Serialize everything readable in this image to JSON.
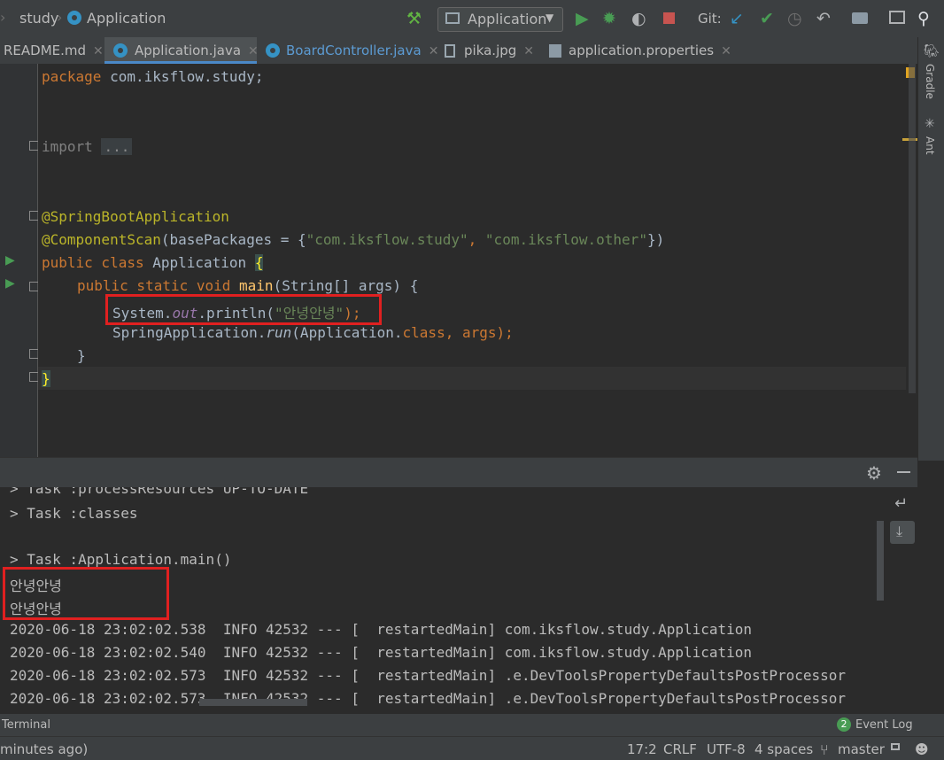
{
  "nav": {
    "breadcrumb_study": "study",
    "breadcrumb_file": "Application",
    "run_config": "Application",
    "git_label": "Git:"
  },
  "tabs": [
    {
      "label": "README.md"
    },
    {
      "label": "Application.java"
    },
    {
      "label": "BoardController.java"
    },
    {
      "label": "pika.jpg"
    },
    {
      "label": "application.properties"
    }
  ],
  "side_tools": {
    "gradle": "Gradle",
    "ant": "Ant"
  },
  "code": {
    "line1_kw": "package",
    "line1_rest": " com.iksflow.study;",
    "import_kw": "import",
    "import_fold": "...",
    "ann1": "@SpringBootApplication",
    "ann2": "@ComponentScan",
    "ann2_open": "(basePackages = {",
    "ann2_str1": "\"com.iksflow.study\"",
    "ann2_comma": ", ",
    "ann2_str2": "\"com.iksflow.other\"",
    "ann2_close": "})",
    "class_kw": "public class",
    "class_name": " Application ",
    "class_brace": "{",
    "main_kw": "public static void",
    "main_name": " main",
    "main_args": "(String[] args) {",
    "println_sys": "System.",
    "println_out": "out",
    "println_call": ".println(",
    "println_str": "\"안녕안녕\"",
    "println_end": ");",
    "run_obj": "SpringApplication.",
    "run_method": "run",
    "run_args1": "(Application.",
    "run_class_kw": "class",
    "run_args2": ", args);",
    "close_method": "}",
    "close_class": "}"
  },
  "console": {
    "lines": [
      "> Task :processResources UP-TO-DATE",
      "> Task :classes",
      "",
      "> Task :Application.main()",
      "안녕안녕",
      "안녕안녕",
      "2020-06-18 23:02:02.538  INFO 42532 --- [  restartedMain] com.iksflow.study.Application",
      "2020-06-18 23:02:02.540  INFO 42532 --- [  restartedMain] com.iksflow.study.Application",
      "2020-06-18 23:02:02.573  INFO 42532 --- [  restartedMain] .e.DevToolsPropertyDefaultsPostProcessor",
      "2020-06-18 23:02:02.573  INFO 42532 --- [  restartedMain] .e.DevToolsPropertyDefaultsPostProcessor"
    ]
  },
  "toolwindow": {
    "terminal": "Terminal",
    "event_log_count": "2",
    "event_log": "Event Log"
  },
  "status": {
    "message": "minutes ago)",
    "position": "17:2",
    "line_sep": "CRLF",
    "encoding": "UTF-8",
    "indent": "4 spaces",
    "branch": "master"
  },
  "colors": {
    "accent": "#4a88c7",
    "run_green": "#499c54",
    "stop_red": "#c75450",
    "highlight_box": "#e02020"
  }
}
